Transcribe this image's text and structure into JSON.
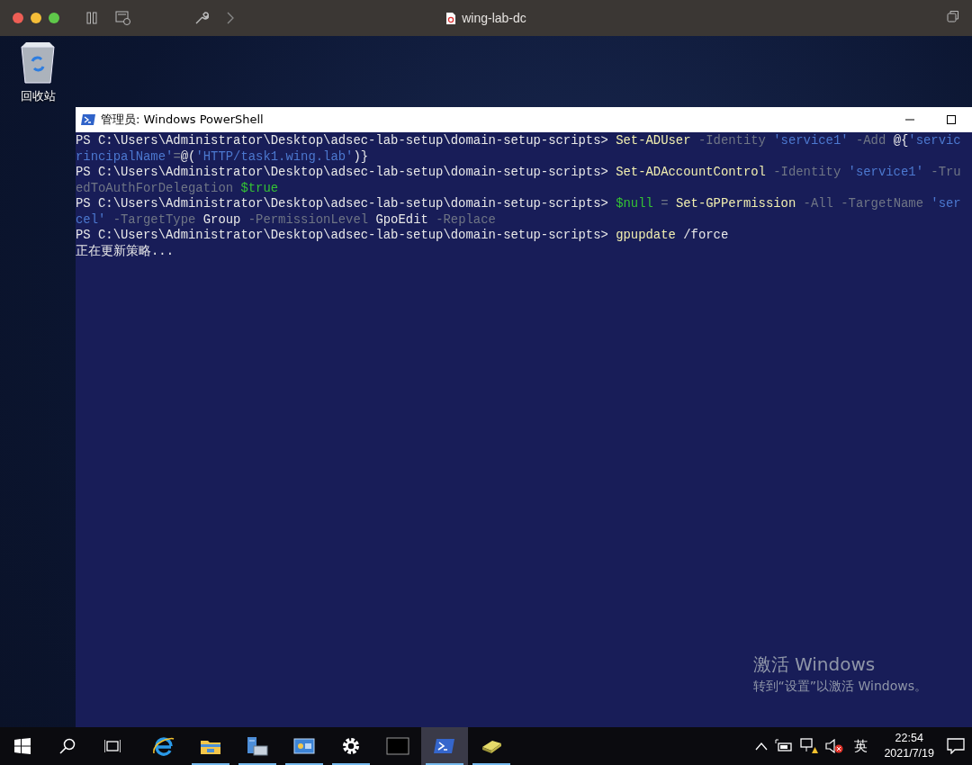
{
  "host_window": {
    "title": "wing-lab-dc"
  },
  "desktop": {
    "icons": [
      {
        "label": "回收站"
      }
    ]
  },
  "powershell": {
    "title": "管理员: Windows PowerShell",
    "lines": [
      {
        "segments": [
          {
            "kind": "prompt",
            "text": "PS C:\\Users\\Administrator\\Desktop\\adsec-lab-setup\\domain-setup-scripts> "
          },
          {
            "kind": "command",
            "text": "Set-ADUser"
          },
          {
            "kind": "param",
            "text": " -Identity "
          },
          {
            "kind": "string",
            "text": "'service1'"
          },
          {
            "kind": "param",
            "text": " -Add "
          },
          {
            "kind": "plain",
            "text": "@{"
          },
          {
            "kind": "string",
            "text": "'servic"
          }
        ]
      },
      {
        "segments": [
          {
            "kind": "string",
            "text": "rincipalName'"
          },
          {
            "kind": "param",
            "text": "="
          },
          {
            "kind": "plain",
            "text": "@("
          },
          {
            "kind": "string",
            "text": "'HTTP/task1.wing.lab'"
          },
          {
            "kind": "plain",
            "text": ")}"
          }
        ]
      },
      {
        "segments": [
          {
            "kind": "prompt",
            "text": "PS C:\\Users\\Administrator\\Desktop\\adsec-lab-setup\\domain-setup-scripts> "
          },
          {
            "kind": "command",
            "text": "Set-ADAccountControl"
          },
          {
            "kind": "param",
            "text": " -Identity "
          },
          {
            "kind": "string",
            "text": "'service1'"
          },
          {
            "kind": "param",
            "text": " -Tru"
          }
        ]
      },
      {
        "segments": [
          {
            "kind": "param",
            "text": "edToAuthForDelegation "
          },
          {
            "kind": "variable",
            "text": "$true"
          }
        ]
      },
      {
        "segments": [
          {
            "kind": "prompt",
            "text": "PS C:\\Users\\Administrator\\Desktop\\adsec-lab-setup\\domain-setup-scripts> "
          },
          {
            "kind": "variable",
            "text": "$null"
          },
          {
            "kind": "param",
            "text": " = "
          },
          {
            "kind": "command",
            "text": "Set-GPPermission"
          },
          {
            "kind": "param",
            "text": " -All -TargetName "
          },
          {
            "kind": "string",
            "text": "'ser"
          }
        ]
      },
      {
        "segments": [
          {
            "kind": "string",
            "text": "cel'"
          },
          {
            "kind": "param",
            "text": " -TargetType "
          },
          {
            "kind": "plain",
            "text": "Group"
          },
          {
            "kind": "param",
            "text": " -PermissionLevel "
          },
          {
            "kind": "plain",
            "text": "GpoEdit"
          },
          {
            "kind": "param",
            "text": " -Replace"
          }
        ]
      },
      {
        "segments": [
          {
            "kind": "prompt",
            "text": "PS C:\\Users\\Administrator\\Desktop\\adsec-lab-setup\\domain-setup-scripts> "
          },
          {
            "kind": "command",
            "text": "gpupdate"
          },
          {
            "kind": "plain",
            "text": " /force"
          }
        ]
      },
      {
        "segments": [
          {
            "kind": "plain",
            "text": "正在更新策略..."
          }
        ]
      }
    ]
  },
  "activation_notice": {
    "heading": "激活 Windows",
    "text": "转到“设置”以激活 Windows。"
  },
  "taskbar": {
    "apps": [
      {
        "kind": "browser",
        "open": false,
        "selected": false
      },
      {
        "kind": "folder",
        "open": true,
        "selected": false
      },
      {
        "kind": "server",
        "open": true,
        "selected": false
      },
      {
        "kind": "panel",
        "open": true,
        "selected": false
      },
      {
        "kind": "gear",
        "open": true,
        "selected": false
      },
      {
        "kind": "terminal",
        "open": false,
        "selected": false
      },
      {
        "kind": "shell",
        "open": true,
        "selected": true
      },
      {
        "kind": "drive",
        "open": true,
        "selected": false
      }
    ],
    "tray": {
      "language": "英",
      "time": "22:54",
      "date": "2021/7/19"
    }
  }
}
